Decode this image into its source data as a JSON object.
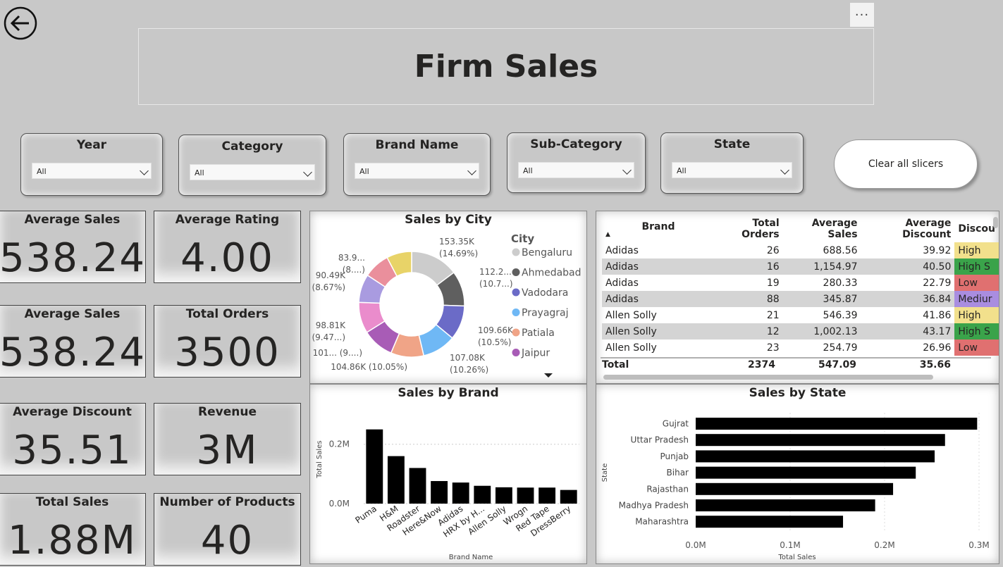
{
  "header": {
    "title": "Firm Sales",
    "more_label": "···"
  },
  "slicers": [
    {
      "title": "Year",
      "value": "All"
    },
    {
      "title": "Category",
      "value": "All"
    },
    {
      "title": "Brand Name",
      "value": "All"
    },
    {
      "title": "Sub-Category",
      "value": "All"
    },
    {
      "title": "State",
      "value": "All"
    }
  ],
  "clear_button": "Clear all slicers",
  "cards": [
    {
      "label": "Average Sales",
      "value": "538.24"
    },
    {
      "label": "Average Rating",
      "value": "4.00"
    },
    {
      "label": "Average Sales",
      "value": "538.24"
    },
    {
      "label": "Total Orders",
      "value": "3500"
    },
    {
      "label": "Average Discount",
      "value": "35.51"
    },
    {
      "label": "Revenue",
      "value": "3M"
    },
    {
      "label": "Total Sales",
      "value": "1.88M"
    },
    {
      "label": "Number of Products",
      "value": "40"
    }
  ],
  "table": {
    "columns": [
      "Brand",
      "Total Orders",
      "Average Sales",
      "Average Discount",
      "Discou"
    ],
    "rows": [
      {
        "brand": "Adidas",
        "orders": "26",
        "avg_sales": "688.56",
        "avg_disc": "39.92",
        "disc": "High",
        "color": "#f2e08c"
      },
      {
        "brand": "Adidas",
        "orders": "16",
        "avg_sales": "1,154.97",
        "avg_disc": "40.50",
        "disc": "High S",
        "color": "#3aa34a"
      },
      {
        "brand": "Adidas",
        "orders": "19",
        "avg_sales": "280.33",
        "avg_disc": "22.79",
        "disc": "Low",
        "color": "#e07070"
      },
      {
        "brand": "Adidas",
        "orders": "88",
        "avg_sales": "345.87",
        "avg_disc": "36.84",
        "disc": "Mediur",
        "color": "#a98de0"
      },
      {
        "brand": "Allen Solly",
        "orders": "21",
        "avg_sales": "546.39",
        "avg_disc": "41.86",
        "disc": "High",
        "color": "#f2e08c"
      },
      {
        "brand": "Allen Solly",
        "orders": "12",
        "avg_sales": "1,002.13",
        "avg_disc": "43.17",
        "disc": "High S",
        "color": "#3aa34a"
      },
      {
        "brand": "Allen Solly",
        "orders": "23",
        "avg_sales": "254.79",
        "avg_disc": "26.96",
        "disc": "Low",
        "color": "#e07070"
      }
    ],
    "total": {
      "label": "Total",
      "orders": "2374",
      "avg_sales": "547.09",
      "avg_disc": "35.66"
    }
  },
  "chart_data": [
    {
      "type": "pie",
      "title": "Sales by City",
      "legend_title": "City",
      "legend": [
        "Bengaluru",
        "Ahmedabad",
        "Vadodara",
        "Prayagraj",
        "Patiala",
        "Jaipur"
      ],
      "slices": [
        {
          "label": "153.35K (14.69%)",
          "value": 153.35,
          "color": "#cccccc"
        },
        {
          "label": "112.2... (10.7...)",
          "value": 112.2,
          "color": "#5f5f5f"
        },
        {
          "label": "109.66K (10.5%)",
          "value": 109.66,
          "color": "#6b6bc7"
        },
        {
          "label": "107.08K (10.26%)",
          "value": 107.08,
          "color": "#6fb8f5"
        },
        {
          "label": "104.86K (10.05%)",
          "value": 104.86,
          "color": "#f0a487"
        },
        {
          "label": "101... (9....)",
          "value": 101,
          "color": "#a85cb6"
        },
        {
          "label": "98.81K (9.47...)",
          "value": 98.81,
          "color": "#ea8ccc"
        },
        {
          "label": "90.49K (8.67%)",
          "value": 90.49,
          "color": "#a99be0"
        },
        {
          "label": "83.9... (8....)",
          "value": 83.9,
          "color": "#ea8f9c"
        },
        {
          "label": "",
          "value": 80,
          "color": "#e8d368"
        }
      ]
    },
    {
      "type": "bar",
      "title": "Sales by Brand",
      "xlabel": "Brand Name",
      "ylabel": "Total Sales",
      "categories": [
        "Puma",
        "H&M",
        "Roadster",
        "Here&Now",
        "Adidas",
        "HRX by H...",
        "Allen Solly",
        "Wrogn",
        "Red Tape",
        "DressBerry"
      ],
      "values": [
        0.25,
        0.16,
        0.12,
        0.076,
        0.071,
        0.06,
        0.055,
        0.054,
        0.054,
        0.046
      ],
      "yticks": [
        "0.0M",
        "0.2M"
      ],
      "ylim": [
        0,
        0.28
      ]
    },
    {
      "type": "bar",
      "orientation": "horizontal",
      "title": "Sales by State",
      "xlabel": "Total Sales",
      "ylabel": "State",
      "categories": [
        "Gujrat",
        "Uttar Pradesh",
        "Punjab",
        "Bihar",
        "Rajasthan",
        "Madhya Pradesh",
        "Maharashtra"
      ],
      "values": [
        0.298,
        0.264,
        0.253,
        0.233,
        0.209,
        0.19,
        0.156
      ],
      "xticks": [
        "0.0M",
        "0.1M",
        "0.2M",
        "0.3M"
      ],
      "xlim": [
        0,
        0.3
      ]
    }
  ]
}
